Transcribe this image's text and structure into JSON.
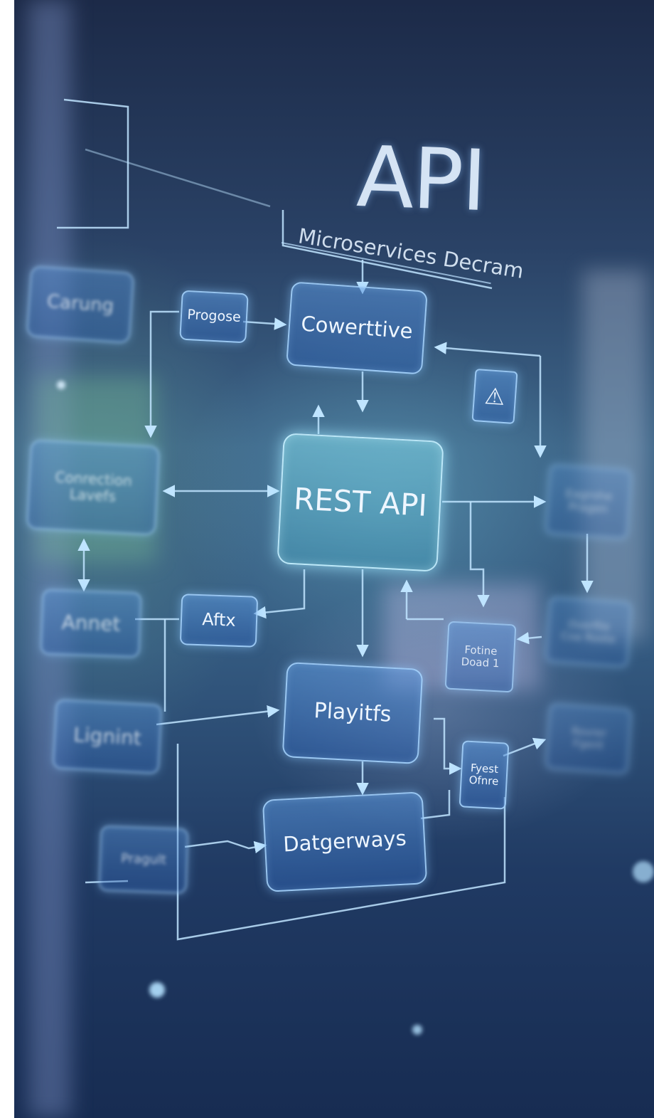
{
  "diagram": {
    "title": "API",
    "subtitle": "Microservices Decram",
    "nodes": {
      "carung": "Carung",
      "progose": "Progose",
      "cowerttive": "Cowerttive",
      "warning": "⚠",
      "connection_left": "Conrection\nLavefs",
      "rest_api": "REST API",
      "right_upper": "Eagrohe\nPragen",
      "annet": "Annet",
      "aftx": "Aftx",
      "fotine": "Fotine\nDoad 1",
      "right_middle": "Overfile\nCoa Roote",
      "lignint": "Lignint",
      "playitfs": "Playitfs",
      "fyest": "Fyest\nOfnre",
      "right_lower": "Rovrer\nFgent",
      "pragult": "Pragult",
      "datgerways": "Datgerways"
    }
  },
  "colors": {
    "wire": "#bfe4ff",
    "box_border": "#aad7ff",
    "background_dark": "#172c52"
  }
}
